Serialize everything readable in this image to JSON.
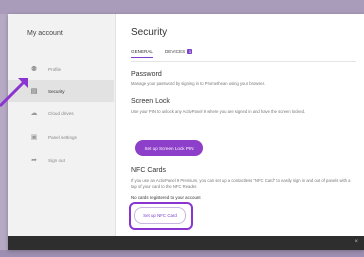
{
  "sidebar": {
    "title": "My account",
    "items": [
      {
        "label": "Profile",
        "icon": "person-icon"
      },
      {
        "label": "Security",
        "icon": "lock-icon"
      },
      {
        "label": "Cloud drives",
        "icon": "cloud-icon"
      },
      {
        "label": "Panel settings",
        "icon": "monitor-settings-icon"
      },
      {
        "label": "Sign out",
        "icon": "sign-out-icon"
      }
    ]
  },
  "main": {
    "title": "Security",
    "tabs": [
      {
        "label": "GENERAL"
      },
      {
        "label": "DEVICES",
        "badge": "3"
      }
    ],
    "password": {
      "heading": "Password",
      "text": "Manage your password by signing in to Promethean using your browser."
    },
    "screen_lock": {
      "heading": "Screen Lock",
      "text": "Use your PIN to unlock any ActivPanel 9 where you are signed in and have the screen locked.",
      "button": "Set up Screen Lock PIN"
    },
    "nfc": {
      "heading": "NFC Cards",
      "text": "If you use an ActivPanel 9 Premium, you can set up a contactless \"NFC Card\" to easily sign in and out of panels with a tap of your card to the NFC Reader.",
      "no_cards": "No cards registered to your account",
      "button": "Set up NFC Card"
    }
  },
  "footer": {
    "close": "×"
  },
  "colors": {
    "accent": "#8e3fc9",
    "highlight": "#8a35d0",
    "background": "#b6a9c4"
  }
}
